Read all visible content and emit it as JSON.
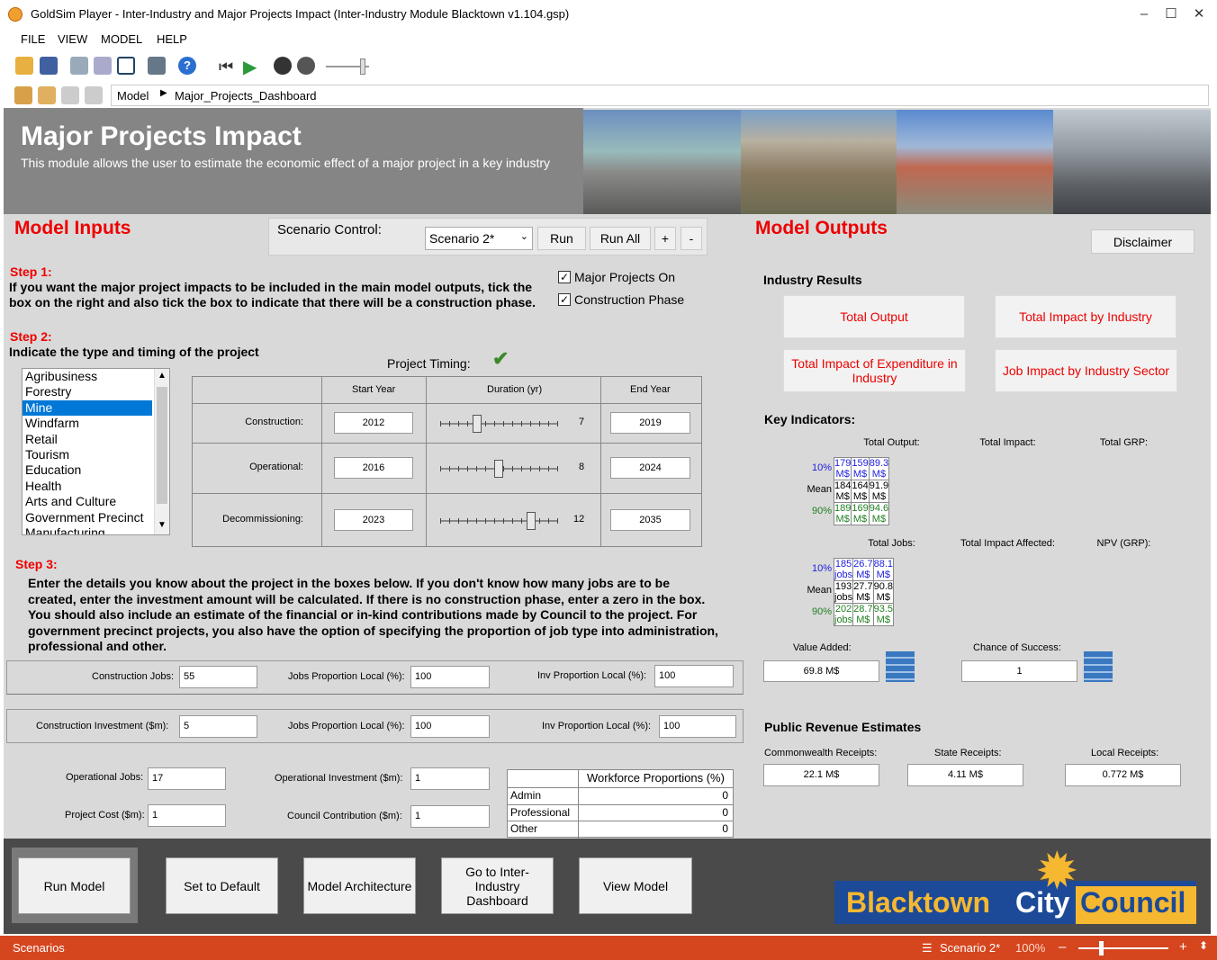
{
  "window": {
    "title": "GoldSim Player - Inter-Industry and Major Projects Impact (Inter-Industry Module  Blacktown v1.104.gsp)"
  },
  "menu": [
    "FILE",
    "VIEW",
    "MODEL",
    "HELP"
  ],
  "path": {
    "root": "Model",
    "current": "Major_Projects_Dashboard"
  },
  "banner": {
    "title": "Major Projects Impact",
    "subtitle": "This module allows the user to estimate the economic effect of a major project in a key industry"
  },
  "inputs": {
    "heading": "Model Inputs",
    "scenario_label": "Scenario Control:",
    "scenario_value": "Scenario 2*",
    "run": "Run",
    "run_all": "Run All",
    "plus": "+",
    "minus": "-",
    "step1": "Step 1:",
    "step1_text": "If you want the major project impacts to be included in the main model outputs, tick the box on the right and also tick the box to indicate that there will be a construction phase.",
    "cb_major": "Major Projects On",
    "cb_construction": "Construction Phase",
    "step2": "Step 2:",
    "step2_text": "Indicate the type and timing of the project",
    "timing_label": "Project Timing:",
    "industries": [
      "Agribusiness",
      "Forestry",
      "Mine",
      "Windfarm",
      "Retail",
      "Tourism",
      "Education",
      "Health",
      "Arts and Culture",
      "Government Precinct",
      "Manufacturing"
    ],
    "selected_industry": "Mine",
    "timing_headers": [
      "Start Year",
      "Duration (yr)",
      "End Year"
    ],
    "timing_rows": [
      {
        "label": "Construction:",
        "start": "2012",
        "duration": "7",
        "end": "2019",
        "slider": 0.3
      },
      {
        "label": "Operational:",
        "start": "2016",
        "duration": "8",
        "end": "2024",
        "slider": 0.5
      },
      {
        "label": "Decommissioning:",
        "start": "2023",
        "duration": "12",
        "end": "2035",
        "slider": 0.8
      }
    ],
    "step3": "Step 3:",
    "step3_text": "Enter the details you know about the project in the boxes below. If you don't know how many jobs are to be created, enter the investment amount will be calculated. If there is no construction phase, enter a zero in the box. You should also include an estimate of the financial or in-kind contributions made by Council to the project. For government precinct projects, you also have the option of specifying the proportion of job type into administration, professional and other.",
    "construction_jobs_label": "Construction Jobs:",
    "construction_jobs": "55",
    "jobs_prop_local_label": "Jobs Proportion Local (%):",
    "jobs_prop_local_1": "100",
    "inv_prop_local_label": "Inv Proportion Local (%):",
    "inv_prop_local_1": "100",
    "construction_inv_label": "Construction Investment ($m):",
    "construction_inv": "5",
    "jobs_prop_local_2": "100",
    "inv_prop_local_2": "100",
    "operational_jobs_label": "Operational Jobs:",
    "operational_jobs": "17",
    "operational_inv_label": "Operational Investment ($m):",
    "operational_inv": "1",
    "project_cost_label": "Project Cost ($m):",
    "project_cost": "1",
    "council_contrib_label": "Council Contribution ($m):",
    "council_contrib": "1",
    "workforce_header": "Workforce Proportions (%)",
    "workforce": [
      {
        "label": "Admin",
        "value": "0"
      },
      {
        "label": "Professional",
        "value": "0"
      },
      {
        "label": "Other",
        "value": "0"
      }
    ]
  },
  "outputs": {
    "heading": "Model Outputs",
    "disclaimer": "Disclaimer",
    "industry_results": "Industry Results",
    "btn_total_output": "Total Output",
    "btn_total_impact": "Total Impact by Industry",
    "btn_expenditure": "Total Impact of Expenditure in Industry",
    "btn_job_impact": "Job Impact by Industry Sector",
    "key_indicators": "Key Indicators:",
    "t1_headers": [
      "Total Output:",
      "Total Impact:",
      "Total GRP:"
    ],
    "t1_rows": [
      {
        "p": "10%",
        "v": [
          "179 M$",
          "159 M$",
          "89.3 M$"
        ]
      },
      {
        "p": "Mean",
        "v": [
          "184 M$",
          "164 M$",
          "91.9 M$"
        ]
      },
      {
        "p": "90%",
        "v": [
          "189 M$",
          "169 M$",
          "94.6 M$"
        ]
      }
    ],
    "t2_headers": [
      "Total Jobs:",
      "Total Impact Affected:",
      "NPV (GRP):"
    ],
    "t2_rows": [
      {
        "p": "10%",
        "v": [
          "185 jobs",
          "26.7 M$",
          "88.1 M$"
        ]
      },
      {
        "p": "Mean",
        "v": [
          "193 jobs",
          "27.7 M$",
          "90.8 M$"
        ]
      },
      {
        "p": "90%",
        "v": [
          "202 jobs",
          "28.7 M$",
          "93.5 M$"
        ]
      }
    ],
    "value_added_label": "Value Added:",
    "value_added": "69.8 M$",
    "chance_label": "Chance of Success:",
    "chance": "1",
    "public_revenue": "Public Revenue Estimates",
    "commonwealth_label": "Commonwealth Receipts:",
    "commonwealth": "22.1 M$",
    "state_label": "State Receipts:",
    "state": "4.11 M$",
    "local_label": "Local Receipts:",
    "local": "0.772 M$"
  },
  "footer": {
    "run_model": "Run Model",
    "set_default": "Set to Default",
    "architecture": "Model Architecture",
    "goto": "Go to Inter-Industry Dashboard",
    "view_model": "View Model",
    "logo_word1": "Blacktown",
    "logo_word2": "City",
    "logo_word3": "Council"
  },
  "status": {
    "left": "Scenarios",
    "scenario": "Scenario 2*",
    "zoom": "100%"
  },
  "colors": {
    "accent_red": "#e00000",
    "status_bar": "#d5461f",
    "low_pct": "#2020e0",
    "high_pct": "#208020"
  }
}
